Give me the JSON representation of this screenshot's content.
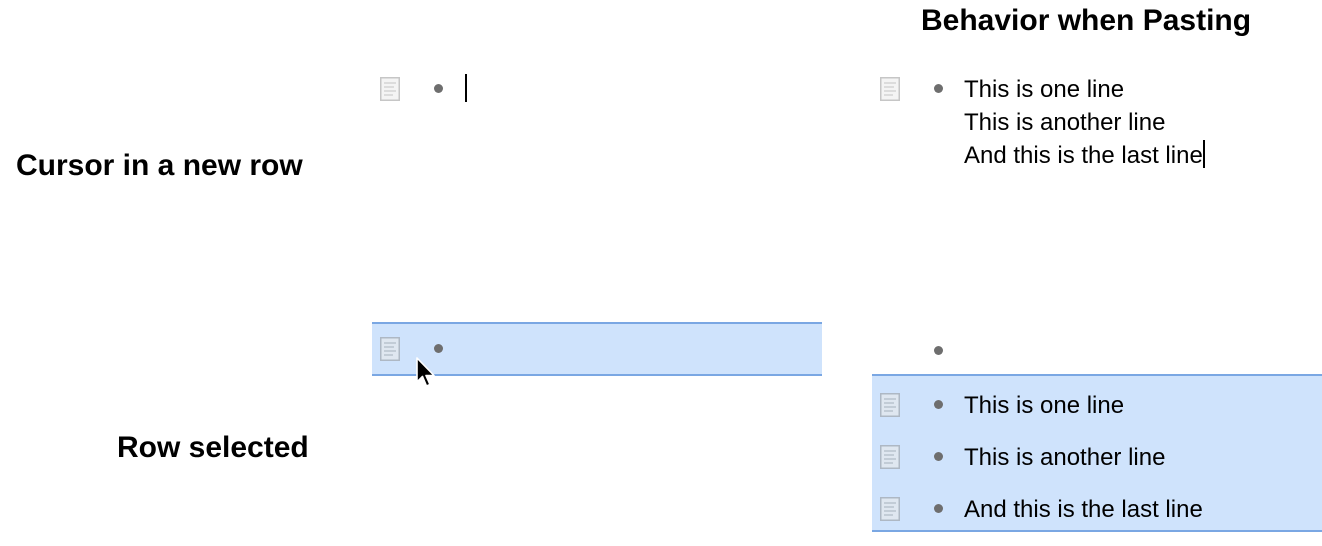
{
  "headings": {
    "pasting": "Behavior when Pasting",
    "cursor_new_row": "Cursor in a new row",
    "row_selected": "Row selected"
  },
  "colors": {
    "selection_fill": "#cfe3fc",
    "selection_border": "#7aa7e3",
    "bullet": "#6e6e6e",
    "doc_icon": "#c6c6c6"
  },
  "top_left": {
    "text": ""
  },
  "top_right": {
    "lines": [
      "This is one line",
      "This is another line",
      "And this is the last line"
    ]
  },
  "bottom_left": {
    "text": ""
  },
  "bottom_right": {
    "empty_row": "",
    "rows": [
      "This is one line",
      "This is another line",
      "And this is the last line"
    ]
  }
}
